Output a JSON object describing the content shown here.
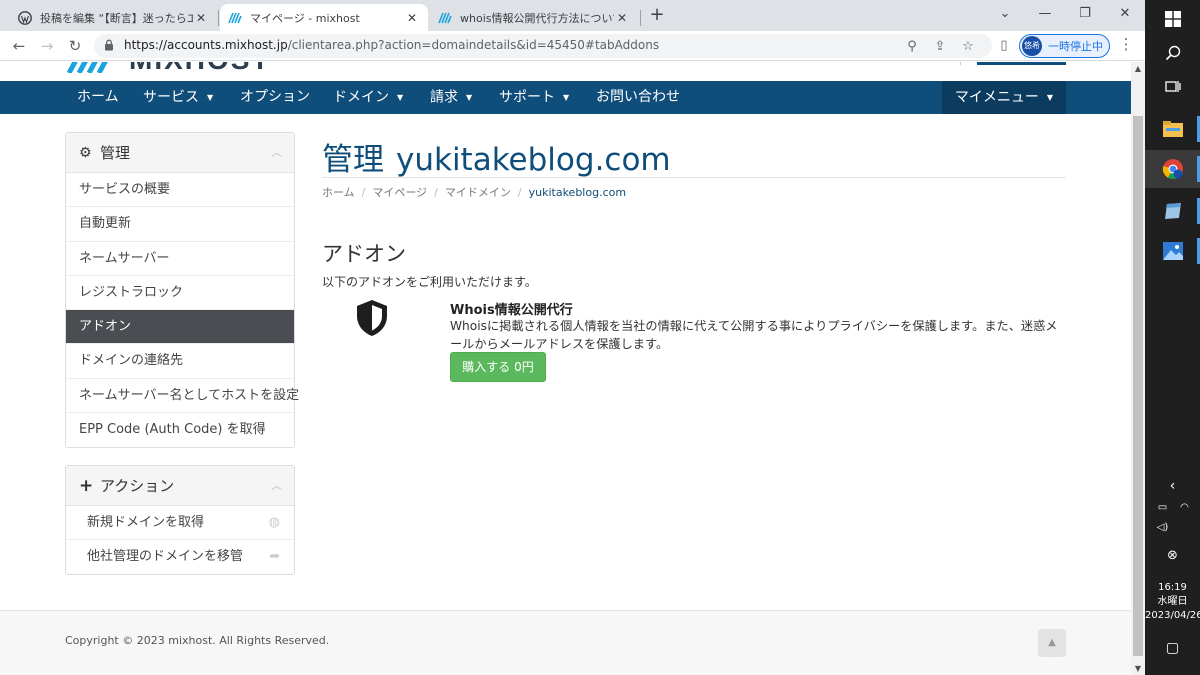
{
  "browser": {
    "tabs": [
      {
        "title": "投稿を編集 “【断言】迷ったらエックス",
        "active": false,
        "favicon": "wordpress-icon"
      },
      {
        "title": "マイページ - mixhost",
        "active": true,
        "favicon": "mixhost-logo-icon"
      },
      {
        "title": "whois情報公開代行方法について - ",
        "active": false,
        "favicon": "mixhost-logo-icon"
      }
    ],
    "url_host": "https://accounts.mixhost.jp",
    "url_path": "/clientarea.php?action=domaindetails&id=45450#tabAddons",
    "profile_avatar_text": "悠希",
    "profile_label": "一時停止中"
  },
  "site": {
    "brand_color": "#0f4d7a",
    "nav": [
      {
        "label": "ホーム",
        "caret": false
      },
      {
        "label": "サービス",
        "caret": true
      },
      {
        "label": "オプション",
        "caret": false
      },
      {
        "label": "ドメイン",
        "caret": true
      },
      {
        "label": "請求",
        "caret": true
      },
      {
        "label": "サポート",
        "caret": true
      },
      {
        "label": "お問い合わせ",
        "caret": false
      }
    ],
    "my_menu": "マイメニュー"
  },
  "sidebar": {
    "manage_title": "管理",
    "manage_items": [
      {
        "label": "サービスの概要",
        "active": false
      },
      {
        "label": "自動更新",
        "active": false
      },
      {
        "label": "ネームサーバー",
        "active": false
      },
      {
        "label": "レジストラロック",
        "active": false
      },
      {
        "label": "アドオン",
        "active": true
      },
      {
        "label": "ドメインの連絡先",
        "active": false
      },
      {
        "label": "ネームサーバー名としてホストを設定",
        "active": false
      },
      {
        "label": "EPP Code (Auth Code) を取得",
        "active": false
      }
    ],
    "actions_title": "アクション",
    "action_items": [
      {
        "label": "新規ドメインを取得",
        "icon": "globe-icon"
      },
      {
        "label": "他社管理のドメインを移管",
        "icon": "share-arrow-icon"
      }
    ]
  },
  "main": {
    "title_lead": "管理",
    "title_domain": "yukitakeblog.com",
    "breadcrumb": [
      "ホーム",
      "マイページ",
      "マイドメイン",
      "yukitakeblog.com"
    ],
    "section_heading": "アドオン",
    "section_sub": "以下のアドオンをご利用いただけます。",
    "addon": {
      "name": "Whois情報公開代行",
      "description": "Whoisに掲載される個人情報を当社の情報に代えて公開する事によりプライバシーを保護します。また、迷惑メールからメールアドレスを保護します。",
      "buy_label": "購入する 0円"
    }
  },
  "footer": {
    "copyright": "Copyright © 2023 mixhost. All Rights Reserved."
  },
  "taskbar": {
    "time": "16:19",
    "weekday": "水曜日",
    "date": "2023/04/26"
  }
}
